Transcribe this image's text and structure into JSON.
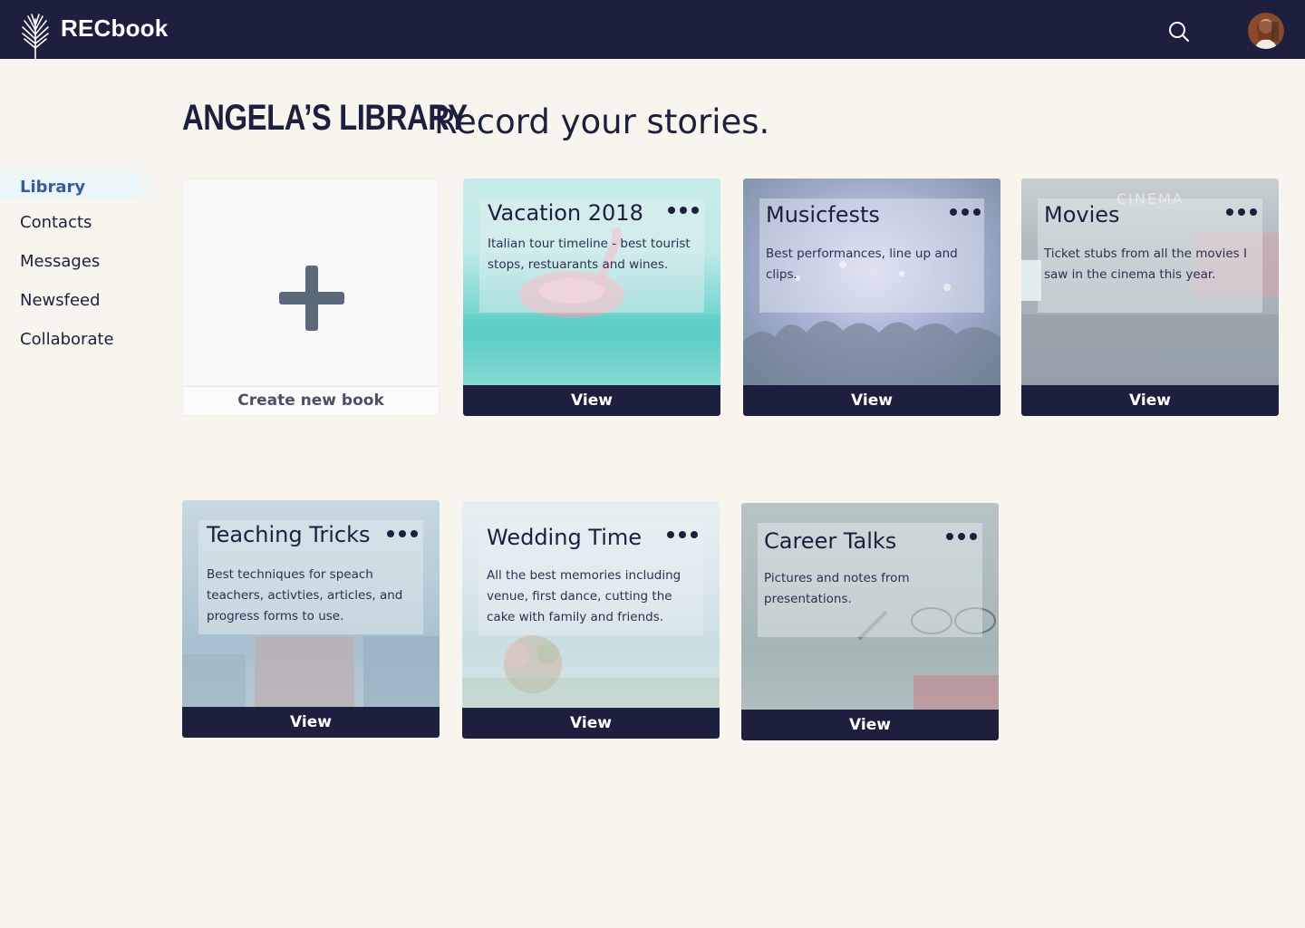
{
  "app": {
    "brand": "RECbook"
  },
  "header": {
    "title": "ANGELA’S LIBRARY",
    "subtitle": "Record your stories."
  },
  "sidebar": {
    "items": [
      {
        "label": "Library",
        "active": true
      },
      {
        "label": "Contacts"
      },
      {
        "label": "Messages"
      },
      {
        "label": "Newsfeed"
      },
      {
        "label": "Collaborate"
      }
    ]
  },
  "create": {
    "label": "Create new book"
  },
  "books": [
    {
      "title": "Vacation 2018",
      "desc": "Italian tour timeline - best tourist stops, restuarants and wines.",
      "view": "View"
    },
    {
      "title": "Musicfests",
      "desc": "Best performances, line up and clips.",
      "view": "View"
    },
    {
      "title": "Movies",
      "desc": "Ticket stubs from all the movies I saw in the cinema this year.",
      "view": "View",
      "bg_text": "CINEMA"
    },
    {
      "title": "Teaching Tricks",
      "desc": "Best techniques for speach teachers, activties, articles, and progress forms to use.",
      "view": "View"
    },
    {
      "title": "Wedding Time",
      "desc": "All the best memories including venue, first dance, cutting the cake with family and friends.",
      "view": "View"
    },
    {
      "title": "Career Talks",
      "desc": "Pictures and notes from presentations.",
      "view": "View"
    }
  ],
  "colors": {
    "navy": "#1c1f3e",
    "background": "#f8f5ef",
    "active_nav": "#3a5aa0"
  },
  "icons": {
    "logo": "palm-leaf-icon",
    "search": "search-icon",
    "more": "more-dots-icon",
    "add": "plus-icon"
  }
}
